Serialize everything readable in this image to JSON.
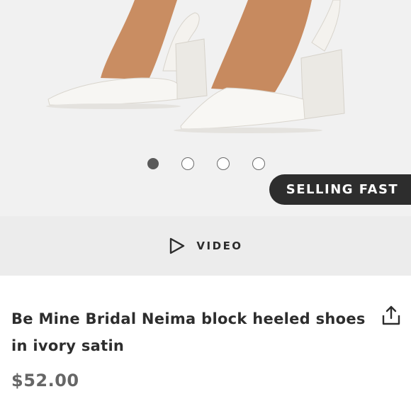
{
  "gallery": {
    "image_count": 4,
    "active_index": 0,
    "badge_label": "SELLING FAST"
  },
  "video": {
    "label": "VIDEO",
    "icon": "play-icon"
  },
  "product": {
    "title": "Be Mine Bridal Neima block heeled shoes in ivory satin",
    "price": "$52.00",
    "share_icon": "share-icon"
  },
  "colors": {
    "badge_bg": "#2d2d2d",
    "active_dot": "#5a5a5a",
    "price_text": "#666666"
  }
}
